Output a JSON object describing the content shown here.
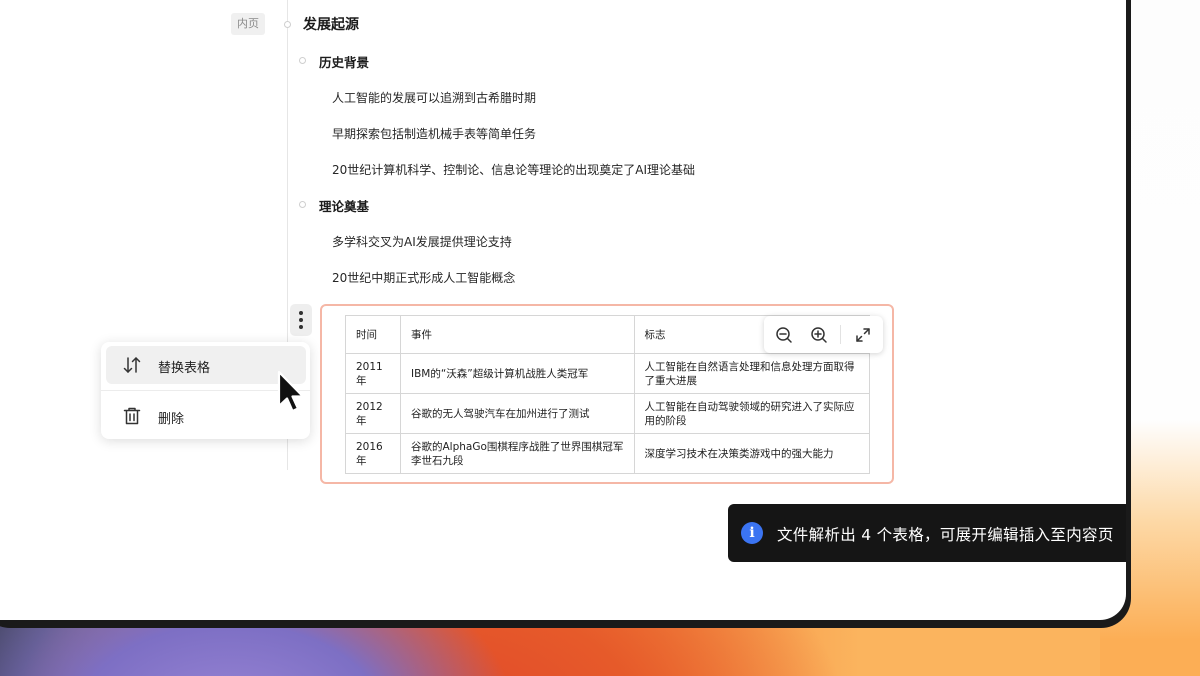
{
  "section_tag": "内页",
  "outline": {
    "title": "发展起源",
    "sections": [
      {
        "heading": "历史背景",
        "items": [
          "人工智能的发展可以追溯到古希腊时期",
          "早期探索包括制造机械手表等简单任务",
          "20世纪计算机科学、控制论、信息论等理论的出现奠定了AI理论基础"
        ]
      },
      {
        "heading": "理论奠基",
        "items": [
          "多学科交叉为AI发展提供理论支持",
          "20世纪中期正式形成人工智能概念"
        ]
      }
    ]
  },
  "table": {
    "headers": [
      "时间",
      "事件",
      "标志"
    ],
    "rows": [
      [
        "2011年",
        "IBM的“沃森”超级计算机战胜人类冠军",
        "人工智能在自然语言处理和信息处理方面取得了重大进展"
      ],
      [
        "2012年",
        "谷歌的无人驾驶汽车在加州进行了测试",
        "人工智能在自动驾驶领域的研究进入了实际应用的阶段"
      ],
      [
        "2016年",
        "谷歌的AlphaGo围棋程序战胜了世界围棋冠军李世石九段",
        "深度学习技术在决策类游戏中的强大能力"
      ]
    ]
  },
  "zoom_toolbar": {
    "icons": [
      "zoom-out-icon",
      "zoom-in-icon",
      "fullscreen-icon"
    ]
  },
  "context_menu": {
    "items": [
      {
        "label": "替换表格",
        "icon": "swap-icon"
      },
      {
        "label": "删除",
        "icon": "trash-icon"
      }
    ]
  },
  "toast": {
    "message": "文件解析出 4 个表格，可展开编辑插入至内容页",
    "icon": "info-icon",
    "accent": "#3b74f2"
  }
}
